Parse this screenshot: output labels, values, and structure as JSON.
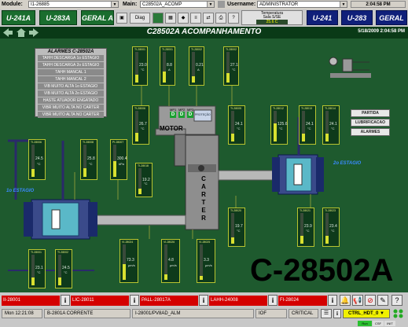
{
  "topbar": {
    "module_label": "Module:",
    "module_value": "I1-26885",
    "main_label": "Main:",
    "main_value": "C28502A_ACOMP",
    "username_label": "Username:",
    "username_value": "ADMINISTRATOR",
    "time": "2:04:58 PM"
  },
  "navbar": {
    "left_buttons": [
      "U-241A",
      "U-283A",
      "GERAL A"
    ],
    "diag_label": "Diag",
    "temperature_label": "Temperatura",
    "temperature_sub": "Sala S/SE",
    "temperature_value": "25.6 C",
    "right_buttons": [
      "U-241",
      "U-283",
      "GERAL"
    ]
  },
  "titlebar": {
    "title": "C28502A ACOMPANHAMENTO",
    "datetime": "5/18/2009  2:04:58 PM"
  },
  "alarm_panel": {
    "title": "ALARMES C-28502A",
    "items": [
      "TAHH DESCARGA 1o ESTAGIO",
      "TAHH DESCARGA 2o ESTAGIO",
      "TAHH MANCAL 1",
      "TAHH MANCAL 2",
      "VIB MUITO ALTA 1o ESTAGIO",
      "VIB MUITO ALTA 2o ESTAGIO",
      "HASTE ATUADOR ENGATADO",
      "VIBR MUITO ALTA NO CARTER",
      "VIBR MUITO ALTA NO CARTER"
    ]
  },
  "right_buttons": [
    "PARTIDA",
    "LUBRIFICACAO",
    "ALARMES"
  ],
  "labels": {
    "motor": "MOTOR",
    "carter": [
      "C",
      "A",
      "R",
      "T",
      "E",
      "R"
    ],
    "stage1": "1o ESTAGIO",
    "stage2": "2o ESTAGIO",
    "big_tag": "C-28502A",
    "motor_indicators": [
      "MP1",
      "MP2",
      "MP3"
    ],
    "motor_status": [
      "D",
      "D",
      "D"
    ],
    "protection": "PROTEÇÃO"
  },
  "transmitters": [
    {
      "tag": "TI-28001",
      "value": "23.0",
      "unit": "°C",
      "level": 0.25
    },
    {
      "tag": "TI-28001",
      "value": "8.8",
      "unit": "A",
      "level": 0.35
    },
    {
      "tag": "TI-28002",
      "value": "0.21",
      "unit": "A",
      "level": 0.2
    },
    {
      "tag": "TI-28002",
      "value": "27.1",
      "unit": "°C",
      "level": 0.3
    },
    {
      "tag": "TI-28006",
      "value": "26.7",
      "unit": "°C",
      "level": 0.28
    },
    {
      "tag": "TI-28005",
      "value": "24.1",
      "unit": "°C",
      "level": 0.25
    },
    {
      "tag": "TI-28012",
      "value": "125.6",
      "unit": "°C",
      "level": 0.6
    },
    {
      "tag": "TI-28013",
      "value": "24.1",
      "unit": "°C",
      "level": 0.25
    },
    {
      "tag": "TI-28014",
      "value": "24.1",
      "unit": "°C",
      "level": 0.25
    },
    {
      "tag": "TI-28006",
      "value": "24.5",
      "unit": "°C",
      "level": 0.25
    },
    {
      "tag": "TI-28008",
      "value": "25.8",
      "unit": "°C",
      "level": 0.27
    },
    {
      "tag": "PI-28007",
      "value": "300.4",
      "unit": "kPa",
      "level": 0.5
    },
    {
      "tag": "TI-28018",
      "value": "19.2",
      "unit": "°C",
      "level": 0.2
    },
    {
      "tag": "TI-28020",
      "value": "19.7",
      "unit": "°C",
      "level": 0.2
    },
    {
      "tag": "TI-28021",
      "value": "23.9",
      "unit": "°C",
      "level": 0.25
    },
    {
      "tag": "TI-28023",
      "value": "23.4",
      "unit": "°C",
      "level": 0.25
    },
    {
      "tag": "TI-28001",
      "value": "23.1",
      "unit": "°C",
      "level": 0.25
    },
    {
      "tag": "TI-28002",
      "value": "24.5",
      "unit": "°C",
      "level": 0.25
    },
    {
      "tag": "VI-28024",
      "value": "73.3",
      "unit": "µm/s",
      "level": 0.45
    },
    {
      "tag": "VI-28026",
      "value": "4.8",
      "unit": "µm/s",
      "level": 0.15
    },
    {
      "tag": "VI-28025",
      "value": "3.3",
      "unit": "µm/s",
      "level": 0.12
    }
  ],
  "alarm_bar": [
    "II-28001",
    "LIC-28011",
    "PALL-28017A",
    "LAHH-24008",
    "FI-28024"
  ],
  "status_bar": {
    "time": "Mon 12:21:08",
    "message": "B-2801A CORRENTE",
    "tag": "I-28001/PV8AD_ALM",
    "state": "IOF",
    "priority": "CRITICAL",
    "ctrl_label": "CTRL_HDT_0"
  },
  "footer_badges": [
    "Run",
    "CSF",
    "INIT"
  ]
}
